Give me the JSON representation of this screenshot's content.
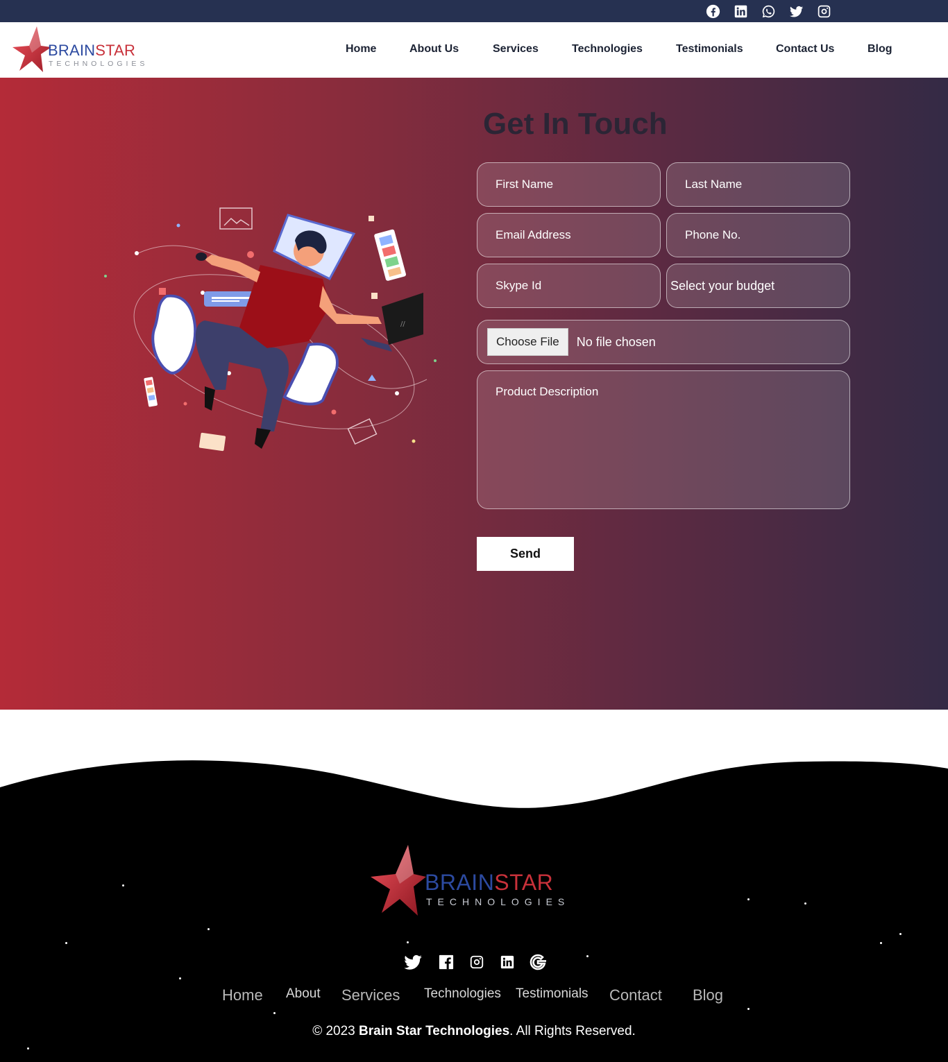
{
  "topbar": {
    "social_icons": [
      "facebook-icon",
      "linkedin-icon",
      "whatsapp-icon",
      "twitter-icon",
      "instagram-icon"
    ]
  },
  "brand": {
    "name_part1": "BRAIN",
    "name_part2": "STAR",
    "tagline": "TECHNOLOGIES",
    "colors": {
      "blue": "#2c4aa0",
      "red": "#c8313a",
      "topbar": "#263151"
    }
  },
  "nav": {
    "items": [
      {
        "label": "Home"
      },
      {
        "label": "About Us"
      },
      {
        "label": "Services"
      },
      {
        "label": "Technologies"
      },
      {
        "label": "Testimonials"
      },
      {
        "label": "Contact Us"
      },
      {
        "label": "Blog"
      }
    ]
  },
  "contact": {
    "title": "Get In Touch",
    "first_name_placeholder": "First Name",
    "last_name_placeholder": "Last Name",
    "email_placeholder": "Email Address",
    "phone_placeholder": "Phone No.",
    "skype_placeholder": "Skype Id",
    "budget_selected": "Select your budget",
    "file_button": "Choose File",
    "file_status": "No file chosen",
    "description_placeholder": "Product Description",
    "send_label": "Send"
  },
  "footer": {
    "social_icons": [
      "twitter-icon",
      "facebook-icon",
      "instagram-icon",
      "linkedin-icon",
      "google-icon"
    ],
    "links": [
      "Home",
      "About",
      "Services",
      "Technologies",
      "Testimonials",
      "Contact",
      "Blog"
    ],
    "copyright_prefix": "© 2023 ",
    "copyright_company": "Brain Star Technologies",
    "copyright_suffix": ". All Rights Reserved."
  }
}
